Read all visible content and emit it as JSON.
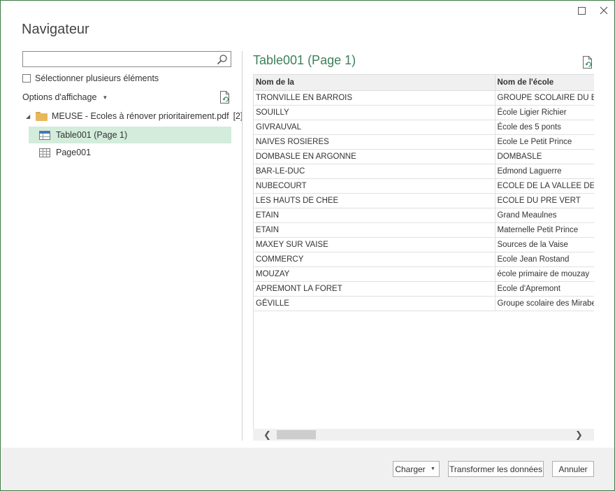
{
  "window": {
    "title": "Navigateur",
    "maximize_glyph": "☐",
    "close_glyph": "✕"
  },
  "left": {
    "search": {
      "value": "",
      "placeholder": ""
    },
    "select_multiple_label": "Sélectionner plusieurs éléments",
    "display_options_label": "Options d'affichage",
    "tree": {
      "parent_label": "MEUSE - Ecoles à rénover prioritairement.pdf",
      "parent_count": "[2]",
      "items": [
        {
          "label": "Table001 (Page 1)",
          "selected": true
        },
        {
          "label": "Page001",
          "selected": false
        }
      ]
    }
  },
  "preview": {
    "title": "Table001 (Page 1)",
    "columns": [
      "Nom de la",
      "Nom de l'école"
    ],
    "rows": [
      [
        "TRONVILLE EN BARROIS",
        "GROUPE SCOLAIRE DU BOUVIER"
      ],
      [
        "SOUILLY",
        "École Ligier Richier"
      ],
      [
        "GIVRAUVAL",
        "École des 5 ponts"
      ],
      [
        "NAIVES ROSIERES",
        "Ecole Le Petit Prince"
      ],
      [
        "DOMBASLE EN ARGONNE",
        "DOMBASLE"
      ],
      [
        "BAR-LE-DUC",
        "Edmond Laguerre"
      ],
      [
        "NUBECOURT",
        "ECOLE DE LA VALLEE DE L'AIRE"
      ],
      [
        "LES HAUTS DE CHEE",
        "ECOLE DU PRE VERT"
      ],
      [
        "ETAIN",
        "Grand Meaulnes"
      ],
      [
        "ETAIN",
        "Maternelle Petit Prince"
      ],
      [
        "MAXEY SUR VAISE",
        "Sources de la Vaise"
      ],
      [
        "COMMERCY",
        "Ecole Jean Rostand"
      ],
      [
        "MOUZAY",
        "école primaire de mouzay"
      ],
      [
        "APREMONT LA FORET",
        "Ecole d'Apremont"
      ],
      [
        "GÉVILLE",
        "Groupe scolaire des Mirabelles"
      ]
    ]
  },
  "footer": {
    "load_label": "Charger",
    "transform_label": "Transformer les données",
    "cancel_label": "Annuler"
  }
}
